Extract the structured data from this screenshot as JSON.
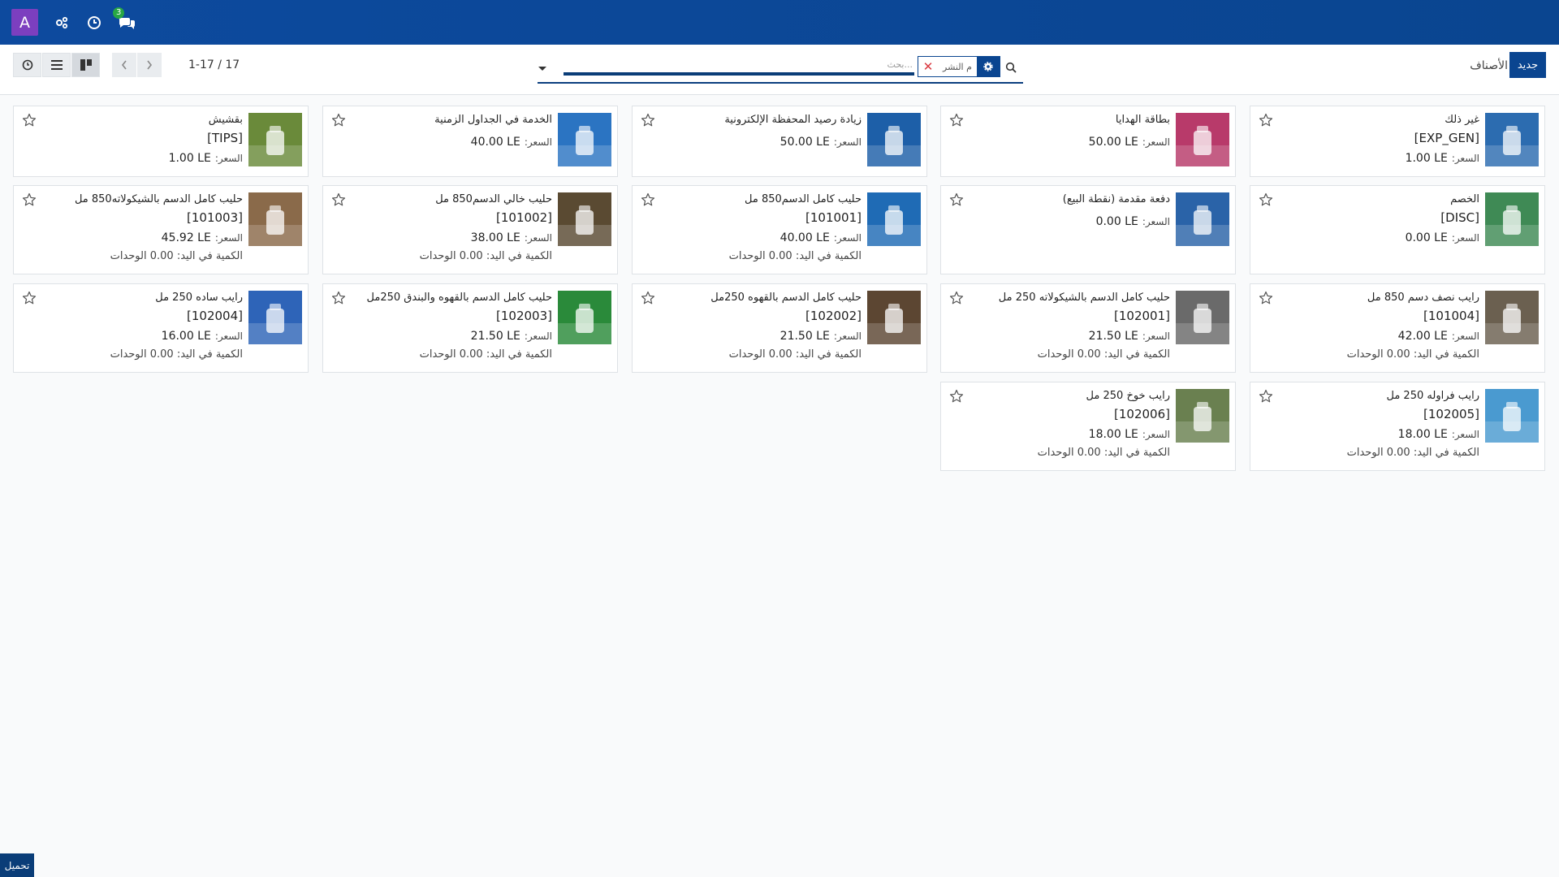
{
  "navbar": {
    "avatar_letter": "A",
    "icons": [
      "apps-icon",
      "clock-icon",
      "chat-icon"
    ],
    "chat_badge": "3",
    "bg": "#0a4590"
  },
  "control": {
    "breadcrumb": "الأصناف",
    "new_button": "جديد",
    "search_placeholder": "بحث...",
    "facet_value": "م النشر",
    "pager_value": "1-17 / 17"
  },
  "products": [
    {
      "name": "غير ذلك",
      "ref": "[EXP_GEN]",
      "price_label": "السعر:",
      "price": "1.00 LE",
      "qty": ""
    },
    {
      "name": "بطاقة الهدايا",
      "ref": "",
      "price_label": "السعر:",
      "price": "50.00 LE",
      "qty": ""
    },
    {
      "name": "زيادة رصيد المحفظة الإلكترونية",
      "ref": "",
      "price_label": "السعر:",
      "price": "50.00 LE",
      "qty": ""
    },
    {
      "name": "الخدمة في الجداول الزمنية",
      "ref": "",
      "price_label": "السعر:",
      "price": "40.00 LE",
      "qty": ""
    },
    {
      "name": "بقشيش",
      "ref": "[TIPS]",
      "price_label": "السعر:",
      "price": "1.00 LE",
      "qty": ""
    },
    {
      "name": "الخصم",
      "ref": "[DISC]",
      "price_label": "السعر:",
      "price": "0.00 LE",
      "qty": ""
    },
    {
      "name": "دفعة مقدمة (نقطة البيع)",
      "ref": "",
      "price_label": "السعر:",
      "price": "0.00 LE",
      "qty": ""
    },
    {
      "name": "حليب كامل الدسم850 مل",
      "ref": "[101001]",
      "price_label": "السعر:",
      "price": "40.00 LE",
      "qty": "الكمية في اليد: 0.00 الوحدات"
    },
    {
      "name": "حليب خالي الدسم850 مل",
      "ref": "[101002]",
      "price_label": "السعر:",
      "price": "38.00 LE",
      "qty": "الكمية في اليد: 0.00 الوحدات"
    },
    {
      "name": "حليب كامل الدسم بالشيكولاته850 مل",
      "ref": "[101003]",
      "price_label": "السعر:",
      "price": "45.92 LE",
      "qty": "الكمية في اليد: 0.00 الوحدات"
    },
    {
      "name": "رايب نصف دسم 850 مل",
      "ref": "[101004]",
      "price_label": "السعر:",
      "price": "42.00 LE",
      "qty": "الكمية في اليد: 0.00 الوحدات"
    },
    {
      "name": "حليب كامل الدسم بالشيكولاته 250 مل",
      "ref": "[102001]",
      "price_label": "السعر:",
      "price": "21.50 LE",
      "qty": "الكمية في اليد: 0.00 الوحدات"
    },
    {
      "name": "حليب كامل الدسم بالقهوه 250مل",
      "ref": "[102002]",
      "price_label": "السعر:",
      "price": "21.50 LE",
      "qty": "الكمية في اليد: 0.00 الوحدات"
    },
    {
      "name": "حليب كامل الدسم بالقهوه والبندق 250مل",
      "ref": "[102003]",
      "price_label": "السعر:",
      "price": "21.50 LE",
      "qty": "الكمية في اليد: 0.00 الوحدات"
    },
    {
      "name": "رايب ساده 250 مل",
      "ref": "[102004]",
      "price_label": "السعر:",
      "price": "16.00 LE",
      "qty": "الكمية في اليد: 0.00 الوحدات"
    },
    {
      "name": "رايب فراوله 250 مل",
      "ref": "[102005]",
      "price_label": "السعر:",
      "price": "18.00 LE",
      "qty": "الكمية في اليد: 0.00 الوحدات"
    },
    {
      "name": "رايب خوخ 250 مل",
      "ref": "[102006]",
      "price_label": "السعر:",
      "price": "18.00 LE",
      "qty": "الكمية في اليد: 0.00 الوحدات"
    }
  ],
  "thumb_colors": [
    "#2c6cb0",
    "#b83a6a",
    "#1d5fa8",
    "#2b74c2",
    "#6a8a3a",
    "#3f8a55",
    "#2a63a8",
    "#1f6bb5",
    "#5a4a32",
    "#8a6a4a",
    "#6b6050",
    "#6a6a6a",
    "#5c4632",
    "#2a8a3a",
    "#2e64b8",
    "#4a9ad0",
    "#6a8050"
  ],
  "footer": {
    "load_button": "تحميل"
  }
}
